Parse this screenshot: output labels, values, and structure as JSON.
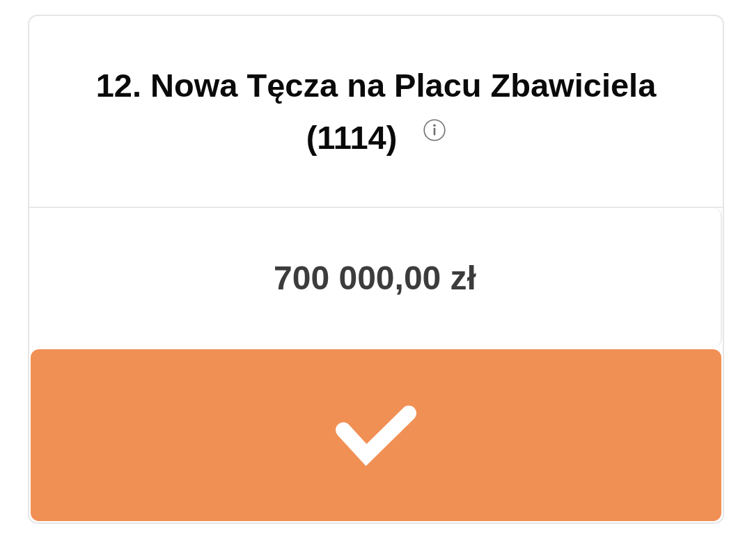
{
  "project": {
    "title": "12. Nowa Tęcza na Placu Zbawiciela",
    "number": "(1114)",
    "amount": "700 000,00 zł",
    "selected": true
  }
}
